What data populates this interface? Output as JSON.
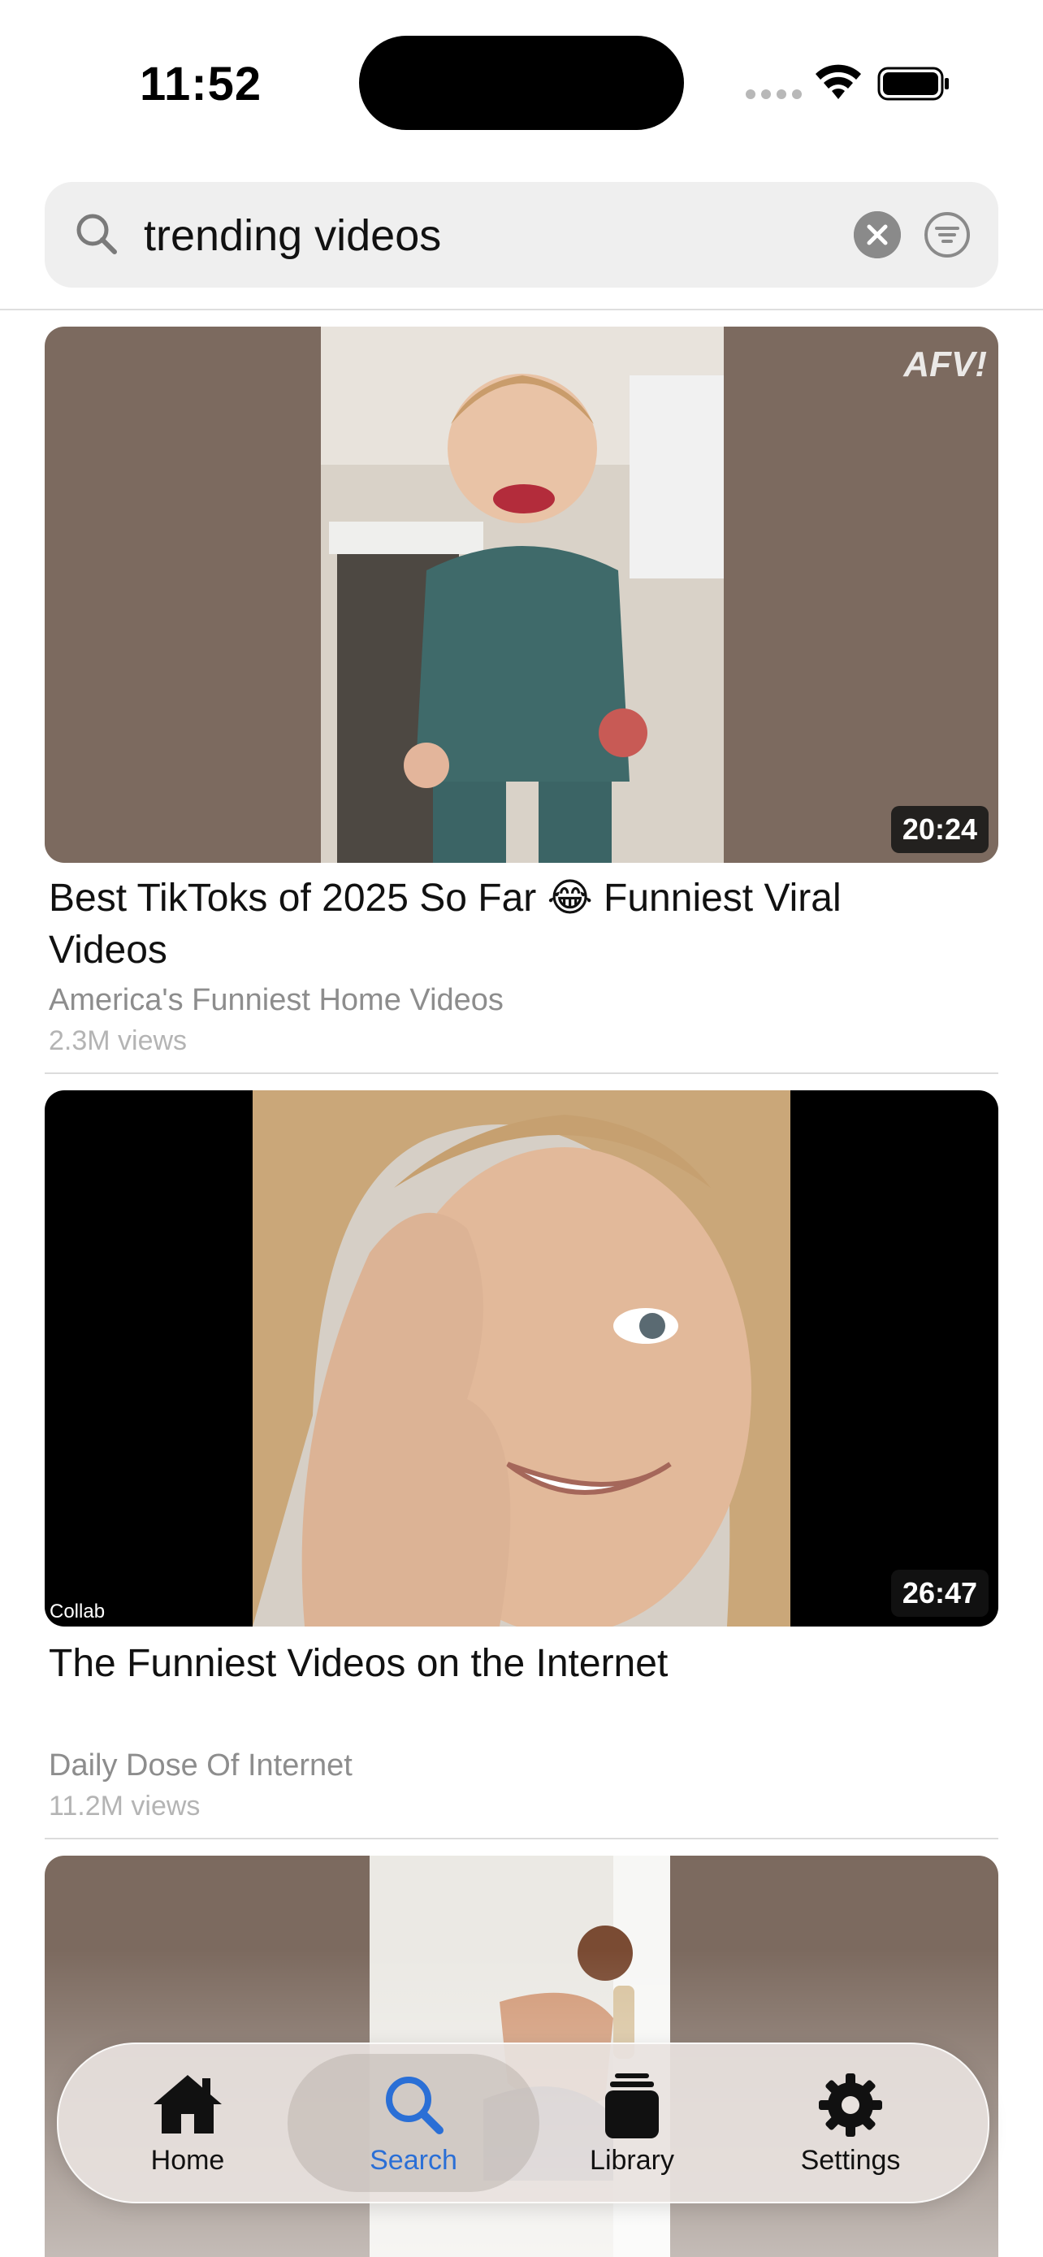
{
  "status_bar": {
    "time": "11:52"
  },
  "search": {
    "query": "trending videos"
  },
  "videos": [
    {
      "title": "Best TikToks of 2025 So Far 😂 Funniest Viral Videos",
      "channel": "America's Funniest Home Videos",
      "views": "2.3M views",
      "duration": "20:24",
      "watermark": "AFV!"
    },
    {
      "title": "The Funniest Videos on the Internet",
      "channel": "Daily Dose Of Internet",
      "views": "11.2M views",
      "duration": "26:47",
      "badge": "Collab"
    },
    {
      "title": "",
      "channel": "",
      "views": "",
      "duration": ""
    }
  ],
  "tab_bar": {
    "active": "Search",
    "tabs": [
      {
        "label": "Home",
        "icon": "house-icon"
      },
      {
        "label": "Search",
        "icon": "magnifier-icon"
      },
      {
        "label": "Library",
        "icon": "stack-icon"
      },
      {
        "label": "Settings",
        "icon": "gear-icon"
      }
    ]
  },
  "colors": {
    "accent": "#2a6fd6",
    "thumb_brown": "#7c6a5f"
  }
}
